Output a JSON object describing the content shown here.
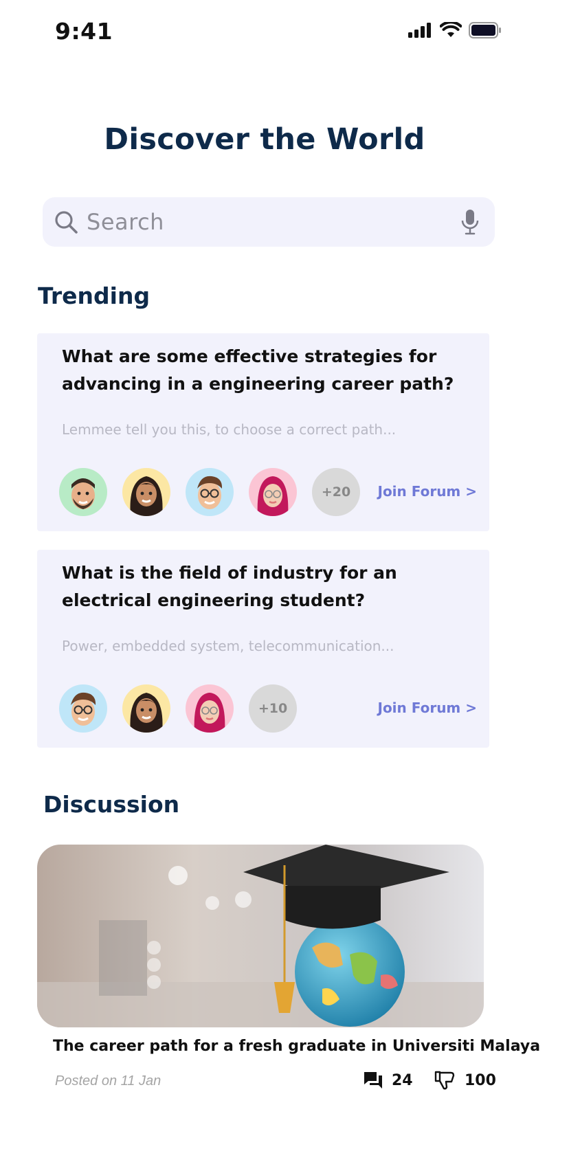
{
  "status_bar": {
    "time": "9:41"
  },
  "header": {
    "title": "Discover the World"
  },
  "search": {
    "placeholder": "Search"
  },
  "trending": {
    "title": "Trending",
    "forums": [
      {
        "question": "What are some effective strategies for advancing in a engineering career path?",
        "snippet": "Lemmee tell you this, to choose a correct path...",
        "more_count": "+20",
        "join_label": "Join Forum >"
      },
      {
        "question": "What is the field of industry for an electrical engineering student?",
        "snippet": "Power, embedded system, telecommunication...",
        "more_count": "+10",
        "join_label": "Join Forum >"
      }
    ]
  },
  "discussion": {
    "title": "Discussion",
    "post": {
      "title": "The career path for a fresh graduate in Universiti Malaya",
      "posted": "Posted on 11 Jan",
      "comments": "24",
      "likes": "100"
    }
  },
  "colors": {
    "heading": "#0e2a4a",
    "card_bg": "#f2f2fc",
    "link": "#6f79d6",
    "avatar_green": "#b8ebc6",
    "avatar_yellow": "#fce7a4",
    "avatar_blue": "#bfe6f8",
    "avatar_pink": "#fbc5d4"
  }
}
